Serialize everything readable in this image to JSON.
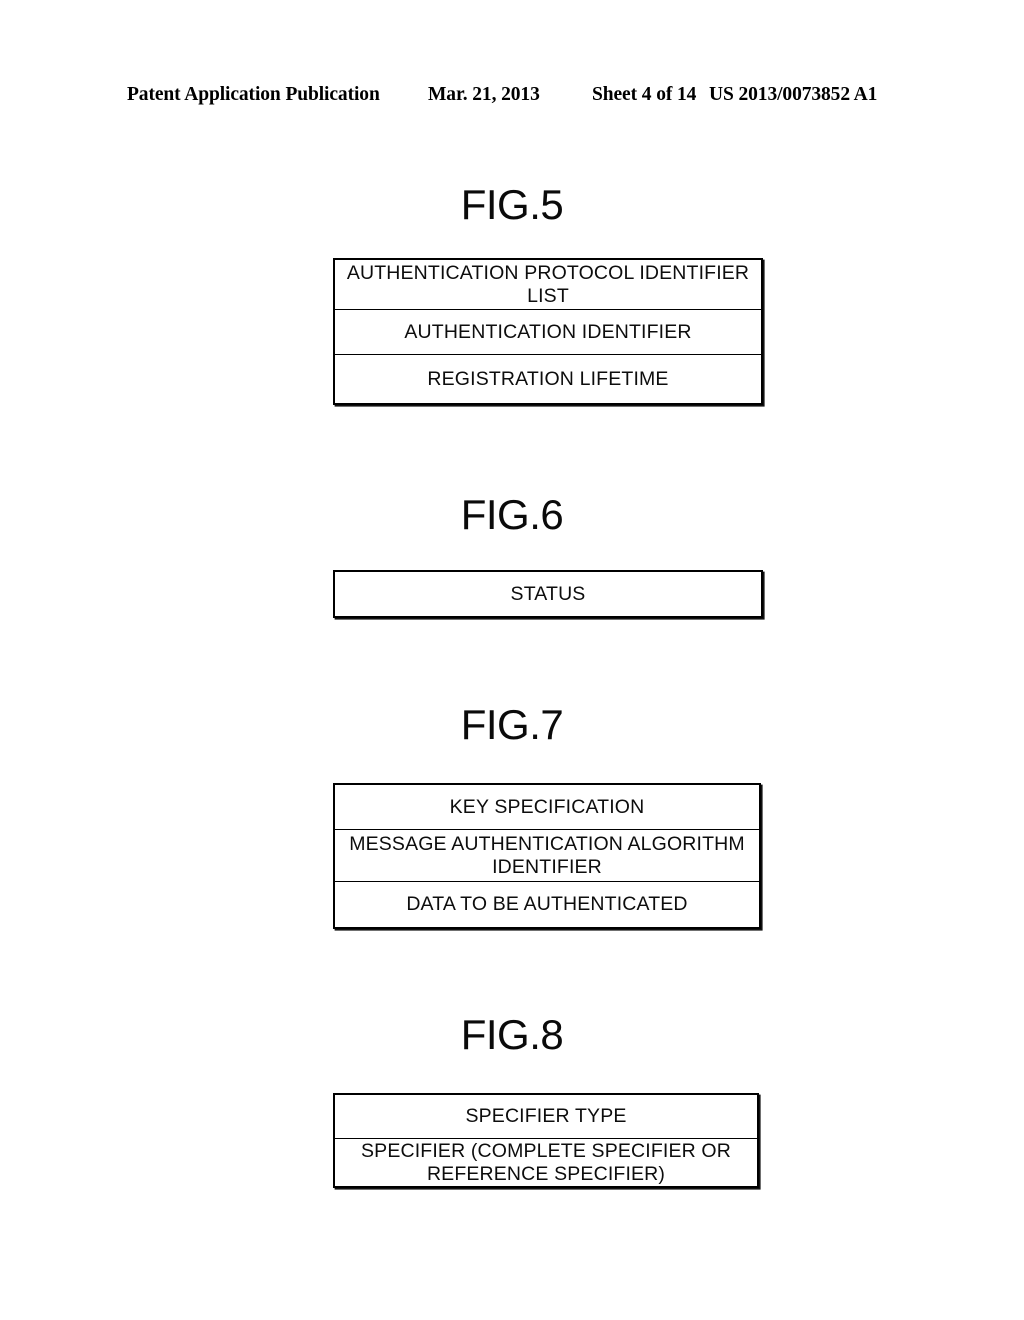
{
  "header": {
    "publication": "Patent Application Publication",
    "date": "Mar. 21, 2013",
    "sheet": "Sheet 4 of 14",
    "document_number": "US 2013/0073852 A1"
  },
  "figures": [
    {
      "id": "fig5",
      "title": "FIG.5",
      "rows": [
        "AUTHENTICATION PROTOCOL IDENTIFIER LIST",
        "AUTHENTICATION IDENTIFIER",
        "REGISTRATION LIFETIME"
      ]
    },
    {
      "id": "fig6",
      "title": "FIG.6",
      "rows": [
        "STATUS"
      ]
    },
    {
      "id": "fig7",
      "title": "FIG.7",
      "rows": [
        "KEY SPECIFICATION",
        "MESSAGE AUTHENTICATION ALGORITHM IDENTIFIER",
        "DATA TO BE AUTHENTICATED"
      ]
    },
    {
      "id": "fig8",
      "title": "FIG.8",
      "rows": [
        "SPECIFIER TYPE",
        "SPECIFIER (COMPLETE SPECIFIER OR REFERENCE SPECIFIER)"
      ]
    }
  ],
  "colors": {
    "ink": "#000000",
    "paper": "#ffffff"
  }
}
